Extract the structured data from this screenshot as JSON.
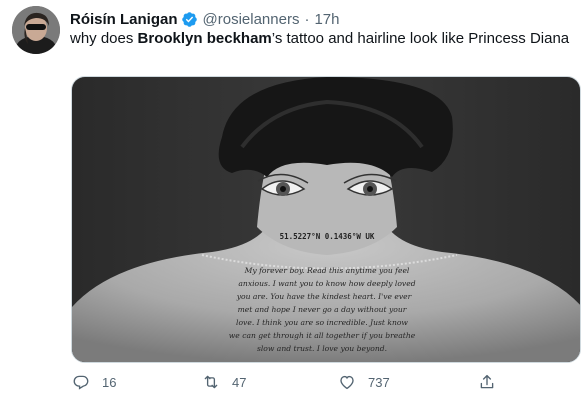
{
  "user": {
    "name": "Róisín Lanigan",
    "handle": "@rosielanners",
    "separator": "·",
    "time": "17h"
  },
  "tweet": {
    "text_before": "why does ",
    "text_bold": "Brooklyn beckham",
    "text_after": "’s tattoo and hairline look like Princess Diana"
  },
  "media": {
    "tattoo_coordinates": "51.5227°N 0.1436°W UK",
    "tattoo_script": [
      "My forever boy. Read this anytime you feel",
      "anxious. I want you to know how deeply loved",
      "you are. You have the kindest heart. I've ever",
      "met and hope I never go a day without your",
      "love. I think you are so incredible. Just know",
      "we can get through it all together if you breathe",
      "slow and trust. I love you beyond."
    ]
  },
  "actions": {
    "replies": "16",
    "retweets": "47",
    "likes": "737"
  },
  "colors": {
    "text": "#0f1419",
    "secondary": "#536471",
    "verified": "#1d9bf0",
    "border": "#cfd9de"
  },
  "icons": [
    "verified-badge-icon",
    "reply-icon",
    "retweet-icon",
    "like-icon",
    "share-icon"
  ]
}
